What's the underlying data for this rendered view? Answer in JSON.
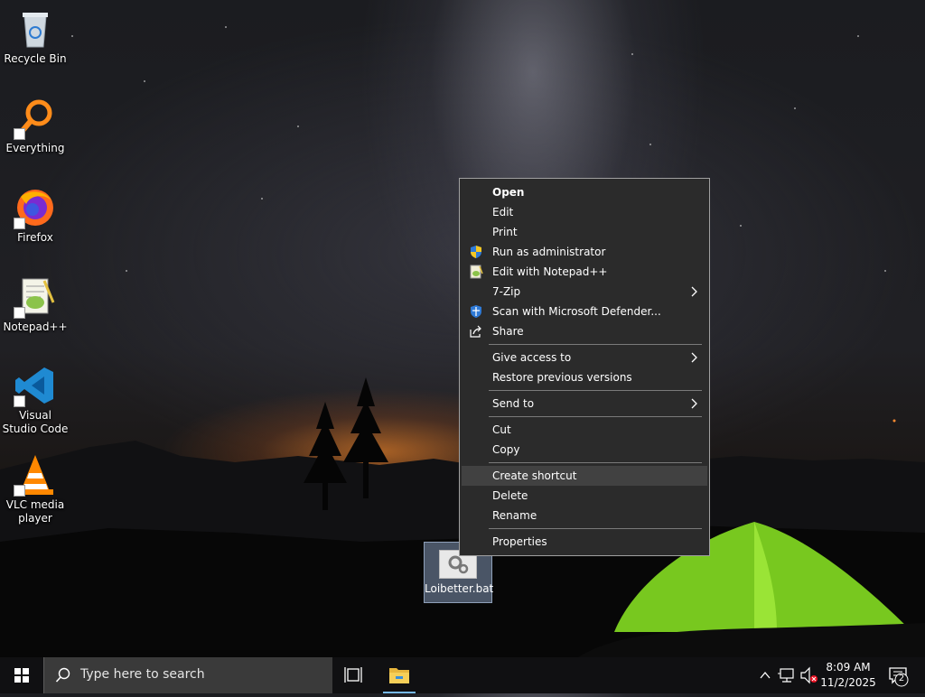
{
  "desktop": {
    "icons": [
      {
        "label": "Recycle Bin",
        "icon": "recycle-bin-icon"
      },
      {
        "label": "Everything",
        "icon": "everything-search-icon"
      },
      {
        "label": "Firefox",
        "icon": "firefox-icon"
      },
      {
        "label": "Notepad++",
        "icon": "notepad-plus-plus-icon"
      },
      {
        "label": "Visual Studio Code",
        "icon": "vscode-icon"
      },
      {
        "label": "VLC media player",
        "icon": "vlc-icon"
      }
    ],
    "selected_file": {
      "label": "Loibetter.bat",
      "icon": "batch-file-icon"
    }
  },
  "context_menu": {
    "items": [
      {
        "label": "Open",
        "bold": true
      },
      {
        "label": "Edit"
      },
      {
        "label": "Print"
      },
      {
        "label": "Run as administrator",
        "icon": "uac-shield-icon"
      },
      {
        "label": "Edit with Notepad++",
        "icon": "notepad-plus-plus-icon"
      },
      {
        "label": "7-Zip",
        "submenu": true
      },
      {
        "label": "Scan with Microsoft Defender...",
        "icon": "defender-shield-icon"
      },
      {
        "label": "Share",
        "icon": "share-icon"
      },
      {
        "label": "Give access to",
        "submenu": true
      },
      {
        "label": "Restore previous versions"
      },
      {
        "label": "Send to",
        "submenu": true
      },
      {
        "label": "Cut"
      },
      {
        "label": "Copy"
      },
      {
        "label": "Create shortcut",
        "highlighted": true
      },
      {
        "label": "Delete"
      },
      {
        "label": "Rename"
      },
      {
        "label": "Properties"
      }
    ]
  },
  "taskbar": {
    "search_placeholder": "Type here to search",
    "clock_time": "8:09 AM",
    "clock_date": "11/2/2025",
    "notification_count": "2"
  },
  "colors": {
    "menu_background": "#2b2b2b",
    "menu_highlight": "#414141",
    "taskbar_background": "#101012",
    "accent": "#3b8edb",
    "tent_green": "#7ed321"
  }
}
